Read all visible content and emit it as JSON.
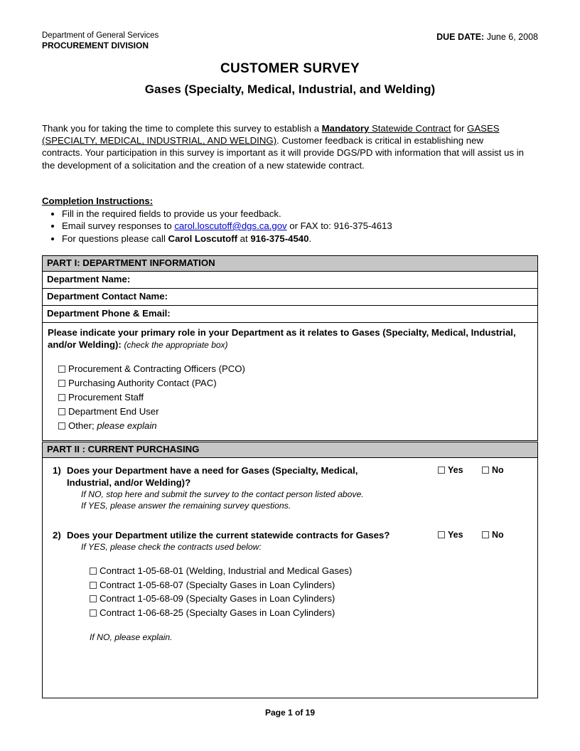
{
  "header": {
    "agency_line1": "Department of General Services",
    "agency_line2": "PROCUREMENT DIVISION",
    "due_label": "DUE DATE:",
    "due_value": "June 6, 2008",
    "title": "CUSTOMER SURVEY",
    "subtitle": "Gases (Specialty, Medical, Industrial, and Welding)"
  },
  "intro": {
    "seg1": "Thank you for taking the time to complete this survey to establish a  ",
    "mandatory": "Mandatory",
    "statewide_contract": " Statewide Contract",
    "seg2": " for ",
    "gases": "GASES (SPECIALTY, MEDICAL, INDUSTRIAL, AND WELDING)",
    "seg3": ".  Customer feedback is critical in establishing new contracts.  Your participation in this survey is important as it will provide DGS/PD with information that will assist us in the development of a solicitation and the creation of a  new statewide contract."
  },
  "completion": {
    "title": "Completion Instructions:",
    "item1": "Fill in the required fields to provide us your feedback.",
    "item2_pre": "Email survey responses to ",
    "item2_email": "carol.loscutoff@dgs.ca.gov",
    "item2_post": " or FAX to:  916-375-4613",
    "item3_pre": "For questions please call ",
    "item3_name": "Carol Loscutoff",
    "item3_mid": " at ",
    "item3_phone": "916-375-4540",
    "item3_post": "."
  },
  "part1": {
    "heading": "PART I: DEPARTMENT INFORMATION",
    "fields": [
      "Department Name:",
      "Department Contact Name:",
      "Department Phone & Email:"
    ],
    "role_question": "Please indicate your primary role in your Department as it relates to Gases (Specialty, Medical, Industrial, and/or Welding):",
    "role_note": "(check the appropriate  box)",
    "roles": [
      "Procurement & Contracting Officers (PCO)",
      "Purchasing Authority Contact (PAC)",
      "Procurement Staff",
      "Department End User"
    ],
    "role_other": "Other;",
    "role_other_italic": " please explain"
  },
  "part2": {
    "heading": "PART II : CURRENT PURCHASING",
    "yes_label": "Yes",
    "no_label": "No",
    "q1": {
      "number": "1)",
      "text": "Does your Department have a need for Gases (Specialty, Medical, Industrial, and/or Welding)?",
      "sub1": "If NO, stop here and submit the survey to the contact person listed above.",
      "sub2": "If YES, please answer the remaining survey questions."
    },
    "q2": {
      "number": "2)",
      "text": "Does your Department utilize the current statewide contracts for Gases?",
      "sub1": "If YES, please check the contracts used below:",
      "contracts": [
        "Contract 1-05-68-01 (Welding, Industrial and Medical Gases)",
        "Contract 1-05-68-07 (Specialty Gases in Loan Cylinders)",
        "Contract 1-05-68-09 (Specialty Gases in Loan Cylinders)",
        "Contract 1-06-68-25 (Specialty Gases in Loan Cylinders)"
      ],
      "ifno": "If NO, please explain."
    }
  },
  "footer": {
    "page_label": "Page 1 of 19"
  }
}
